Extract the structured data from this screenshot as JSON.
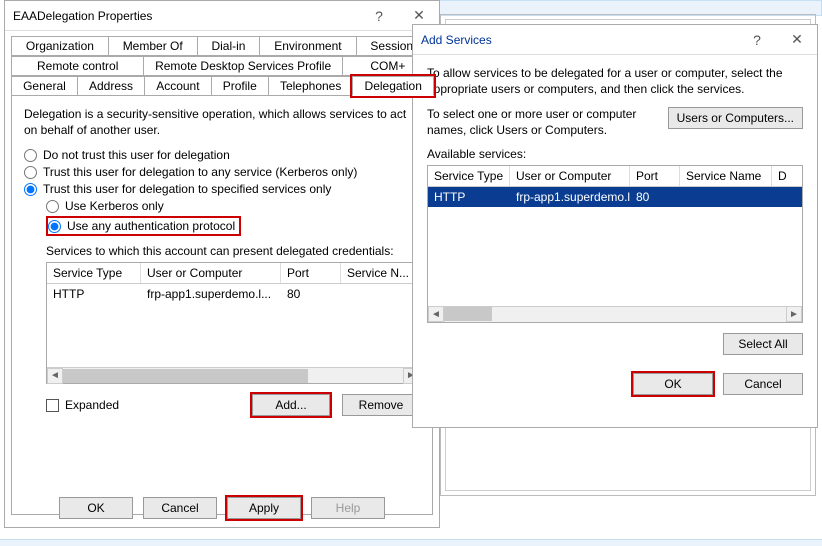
{
  "props_window": {
    "title": "EAADelegation Properties",
    "tabs_row1": [
      "Organization",
      "Member Of",
      "Dial-in",
      "Environment",
      "Sessions"
    ],
    "tabs_row2": [
      "Remote control",
      "Remote Desktop Services Profile",
      "COM+"
    ],
    "tabs_row3": [
      "General",
      "Address",
      "Account",
      "Profile",
      "Telephones",
      "Delegation"
    ],
    "delegation": {
      "intro": "Delegation is a security-sensitive operation, which allows services to act on behalf of another user.",
      "radio_no_trust": "Do not trust this user for delegation",
      "radio_any_service": "Trust this user for delegation to any service (Kerberos only)",
      "radio_specified": "Trust this user for delegation to specified services only",
      "radio_kerberos_only": "Use Kerberos only",
      "radio_any_auth": "Use any authentication protocol",
      "services_caption": "Services to which this account can present delegated credentials:",
      "columns": {
        "c1": "Service Type",
        "c2": "User or Computer",
        "c3": "Port",
        "c4": "Service N..."
      },
      "row": {
        "c1": "HTTP",
        "c2": "frp-app1.superdemo.l...",
        "c3": "80",
        "c4": ""
      },
      "expanded_label": "Expanded",
      "add_btn": "Add...",
      "remove_btn": "Remove"
    },
    "buttons": {
      "ok": "OK",
      "cancel": "Cancel",
      "apply": "Apply",
      "help": "Help"
    }
  },
  "add_window": {
    "title": "Add Services",
    "intro1": "To allow services to be delegated for a user or computer, select the appropriate users or computers, and then click the services.",
    "intro2": "To select one or more user or computer names, click Users or Computers.",
    "users_computers_btn": "Users or Computers...",
    "available_label": "Available services:",
    "columns": {
      "c1": "Service Type",
      "c2": "User or Computer",
      "c3": "Port",
      "c4": "Service Name",
      "c5": "D"
    },
    "row": {
      "c1": "HTTP",
      "c2": "frp-app1.superdemo.l...",
      "c3": "80",
      "c4": "",
      "c5": ""
    },
    "select_all_btn": "Select All",
    "ok_btn": "OK",
    "cancel_btn": "Cancel"
  }
}
